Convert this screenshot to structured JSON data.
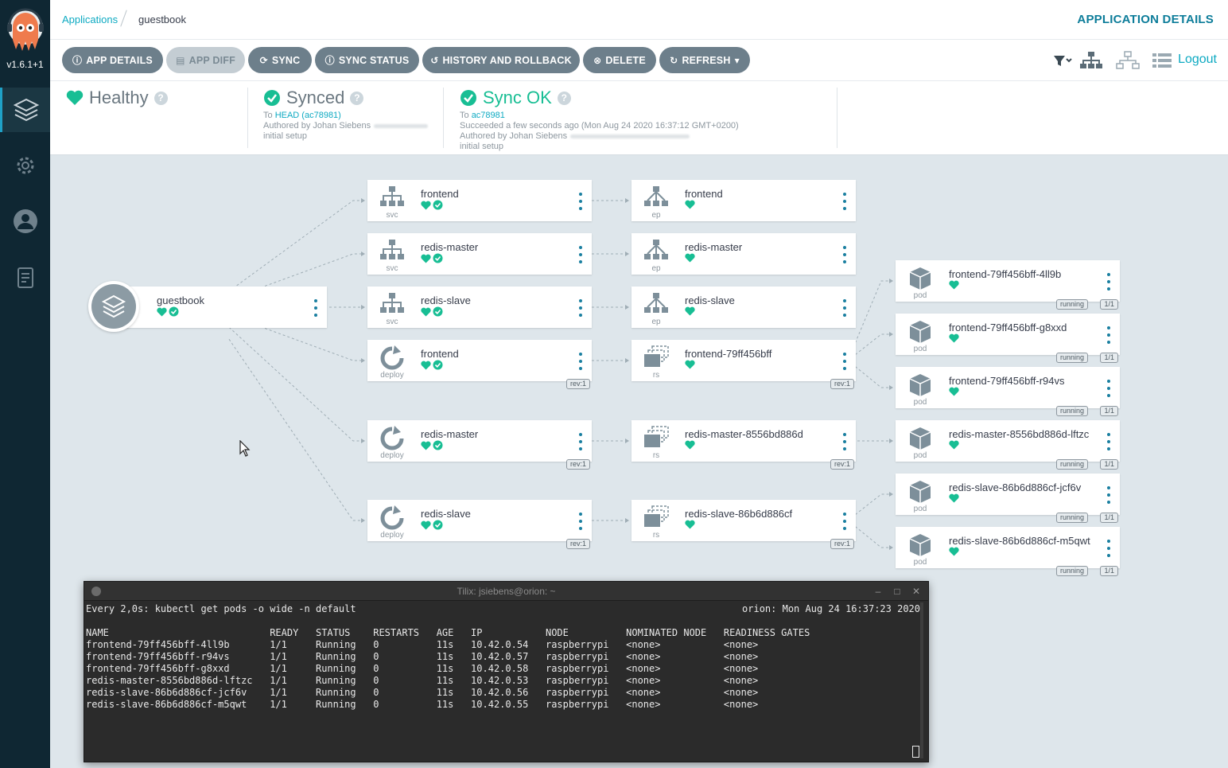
{
  "sidebar": {
    "version": "v1.6.1+1",
    "items": [
      {
        "name": "applications-icon",
        "active": true
      },
      {
        "name": "settings-icon",
        "active": false
      },
      {
        "name": "user-icon",
        "active": false
      },
      {
        "name": "docs-icon",
        "active": false
      }
    ]
  },
  "header": {
    "breadcrumb_link": "Applications",
    "breadcrumb_current": "guestbook",
    "title": "APPLICATION DETAILS"
  },
  "toolbar": {
    "buttons": [
      {
        "label": "APP DETAILS",
        "icon": "info-icon"
      },
      {
        "label": "APP DIFF",
        "icon": "file-diff-icon"
      },
      {
        "label": "SYNC",
        "icon": "sync-icon"
      },
      {
        "label": "SYNC STATUS",
        "icon": "info-icon"
      },
      {
        "label": "HISTORY AND ROLLBACK",
        "icon": "history-icon"
      },
      {
        "label": "DELETE",
        "icon": "delete-icon"
      },
      {
        "label": "REFRESH",
        "icon": "refresh-icon"
      }
    ],
    "logout": "Logout"
  },
  "status": {
    "health": "Healthy",
    "sync": {
      "title": "Synced",
      "to_prefix": "To",
      "to_link": "HEAD (ac78981)",
      "author": "Authored by Johan Siebens",
      "message": "initial setup"
    },
    "operation": {
      "title": "Sync OK",
      "to_prefix": "To",
      "to_link": "ac78981",
      "succeeded": "Succeeded a few seconds ago (Mon Aug 24 2020 16:37:12 GMT+0200)",
      "author": "Authored by Johan Siebens",
      "message": "initial setup"
    }
  },
  "graph": {
    "app": {
      "name": "guestbook"
    },
    "col1": [
      {
        "name": "frontend",
        "kind": "svc"
      },
      {
        "name": "redis-master",
        "kind": "svc"
      },
      {
        "name": "redis-slave",
        "kind": "svc"
      },
      {
        "name": "frontend",
        "kind": "deploy",
        "tag": "rev:1"
      },
      {
        "name": "redis-master",
        "kind": "deploy",
        "tag": "rev:1"
      },
      {
        "name": "redis-slave",
        "kind": "deploy",
        "tag": "rev:1"
      }
    ],
    "col2": [
      {
        "name": "frontend",
        "kind": "ep"
      },
      {
        "name": "redis-master",
        "kind": "ep"
      },
      {
        "name": "redis-slave",
        "kind": "ep"
      },
      {
        "name": "frontend-79ff456bff",
        "kind": "rs",
        "tag": "rev:1"
      },
      {
        "name": "redis-master-8556bd886d",
        "kind": "rs",
        "tag": "rev:1"
      },
      {
        "name": "redis-slave-86b6d886cf",
        "kind": "rs",
        "tag": "rev:1"
      }
    ],
    "col3": [
      {
        "name": "frontend-79ff456bff-4ll9b",
        "kind": "pod",
        "state": "running",
        "ready": "1/1"
      },
      {
        "name": "frontend-79ff456bff-g8xxd",
        "kind": "pod",
        "state": "running",
        "ready": "1/1"
      },
      {
        "name": "frontend-79ff456bff-r94vs",
        "kind": "pod",
        "state": "running",
        "ready": "1/1"
      },
      {
        "name": "redis-master-8556bd886d-lftzc",
        "kind": "pod",
        "state": "running",
        "ready": "1/1"
      },
      {
        "name": "redis-slave-86b6d886cf-jcf6v",
        "kind": "pod",
        "state": "running",
        "ready": "1/1"
      },
      {
        "name": "redis-slave-86b6d886cf-m5qwt",
        "kind": "pod",
        "state": "running",
        "ready": "1/1"
      }
    ]
  },
  "terminal": {
    "title": "Tilix: jsiebens@orion: ~",
    "watch_line": "Every 2,0s: kubectl get pods -o wide -n default",
    "watch_right": "orion: Mon Aug 24 16:37:23 2020",
    "table": "NAME                            READY   STATUS    RESTARTS   AGE   IP           NODE          NOMINATED NODE   READINESS GATES\nfrontend-79ff456bff-4ll9b       1/1     Running   0          11s   10.42.0.54   raspberrypi   <none>           <none>\nfrontend-79ff456bff-r94vs       1/1     Running   0          11s   10.42.0.57   raspberrypi   <none>           <none>\nfrontend-79ff456bff-g8xxd       1/1     Running   0          11s   10.42.0.58   raspberrypi   <none>           <none>\nredis-master-8556bd886d-lftzc   1/1     Running   0          11s   10.42.0.53   raspberrypi   <none>           <none>\nredis-slave-86b6d886cf-jcf6v    1/1     Running   0          11s   10.42.0.56   raspberrypi   <none>           <none>\nredis-slave-86b6d886cf-m5qwt    1/1     Running   0          11s   10.42.0.55   raspberrypi   <none>           <none>"
  },
  "colors": {
    "accent": "#0eaac2",
    "healthy": "#18be94",
    "sidebar": "#0f2733",
    "button": "#6d7f8b"
  }
}
